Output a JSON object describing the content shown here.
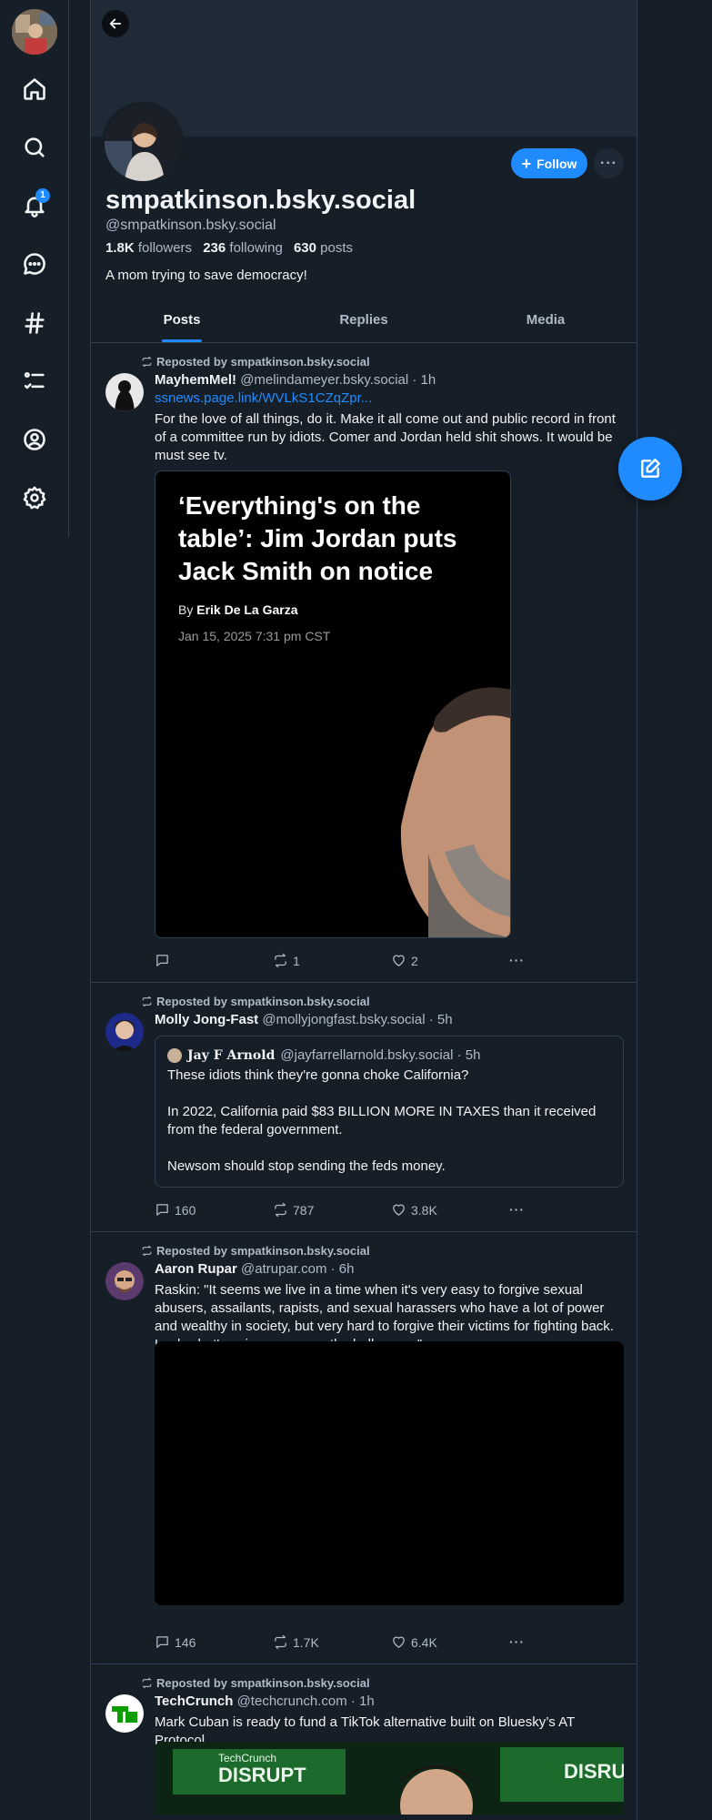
{
  "navigation": {
    "notifications_count": "1",
    "icons": [
      "home-icon",
      "search-icon",
      "bell-icon",
      "chat-icon",
      "hashtag-icon",
      "list-icon",
      "profile-icon",
      "gear-icon"
    ]
  },
  "profile": {
    "display_name": "smpatkinson.bsky.social",
    "handle": "@smpatkinson.bsky.social",
    "followers_count": "1.8K",
    "followers_label": "followers",
    "following_count": "236",
    "following_label": "following",
    "posts_count": "630",
    "posts_label": "posts",
    "bio": "A mom trying to save democracy!",
    "follow_label": "Follow",
    "more_label": "···"
  },
  "tabs": [
    {
      "label": "Posts",
      "active": true
    },
    {
      "label": "Replies",
      "active": false
    },
    {
      "label": "Media",
      "active": false
    }
  ],
  "posts": [
    {
      "repost_label": "Reposted by smpatkinson.bsky.social",
      "author": "MayhemMel!",
      "handle_time": "@melindameyer.bsky.social · 1h",
      "link": "ssnews.page.link/WVLkS1CZqZpr...",
      "text": "For the love of all things, do it. Make it all come out and public record in front of a committee run by idiots. Comer and Jordan held shit shows. It would be must see tv.",
      "article": {
        "title": "‘Everything's on the table’: Jim Jordan puts Jack Smith on notice",
        "by_prefix": "By",
        "author": "Erik De La Garza",
        "date": "Jan 15, 2025 7:31 pm CST"
      },
      "replies": "",
      "reposts": "1",
      "likes": "2"
    },
    {
      "repost_label": "Reposted by smpatkinson.bsky.social",
      "author": "Molly Jong-Fast",
      "handle_time": "@mollyjongfast.bsky.social · 5h",
      "quote": {
        "author": "𝐉𝐚𝐲 𝐅 𝐀𝐫𝐧𝐨𝐥𝐝",
        "handle_time": "@jayfarrellarnold.bsky.social · 5h",
        "text": "These idiots think they're gonna choke California?\n\nIn 2022, California paid $83 BILLION MORE IN TAXES than it received from the federal government.\n\nNewsom should stop sending the feds money."
      },
      "replies": "160",
      "reposts": "787",
      "likes": "3.8K"
    },
    {
      "repost_label": "Reposted by smpatkinson.bsky.social",
      "author": "Aaron Rupar",
      "handle_time": "@atrupar.com · 6h",
      "text": "Raskin: \"It seems we live in a time when it's very easy to forgive sexual abusers, assailants, rapists, and sexual harassers who have a lot of power and wealthy in society, but very hard to forgive their victims for fighting back. Look what's going on across the hallway ... \"",
      "replies": "146",
      "reposts": "1.7K",
      "likes": "6.4K"
    },
    {
      "repost_label": "Reposted by smpatkinson.bsky.social",
      "author": "TechCrunch",
      "handle_time": "@techcrunch.com · 1h",
      "text": "Mark Cuban is ready to fund a TikTok alternative built on Bluesky’s AT Protocol",
      "image_text": "TechCrunch DISRUPT"
    }
  ],
  "colors": {
    "background": "#161e27",
    "accent": "#208bfe",
    "muted_text": "#aebbc9",
    "border": "#2e4052"
  }
}
